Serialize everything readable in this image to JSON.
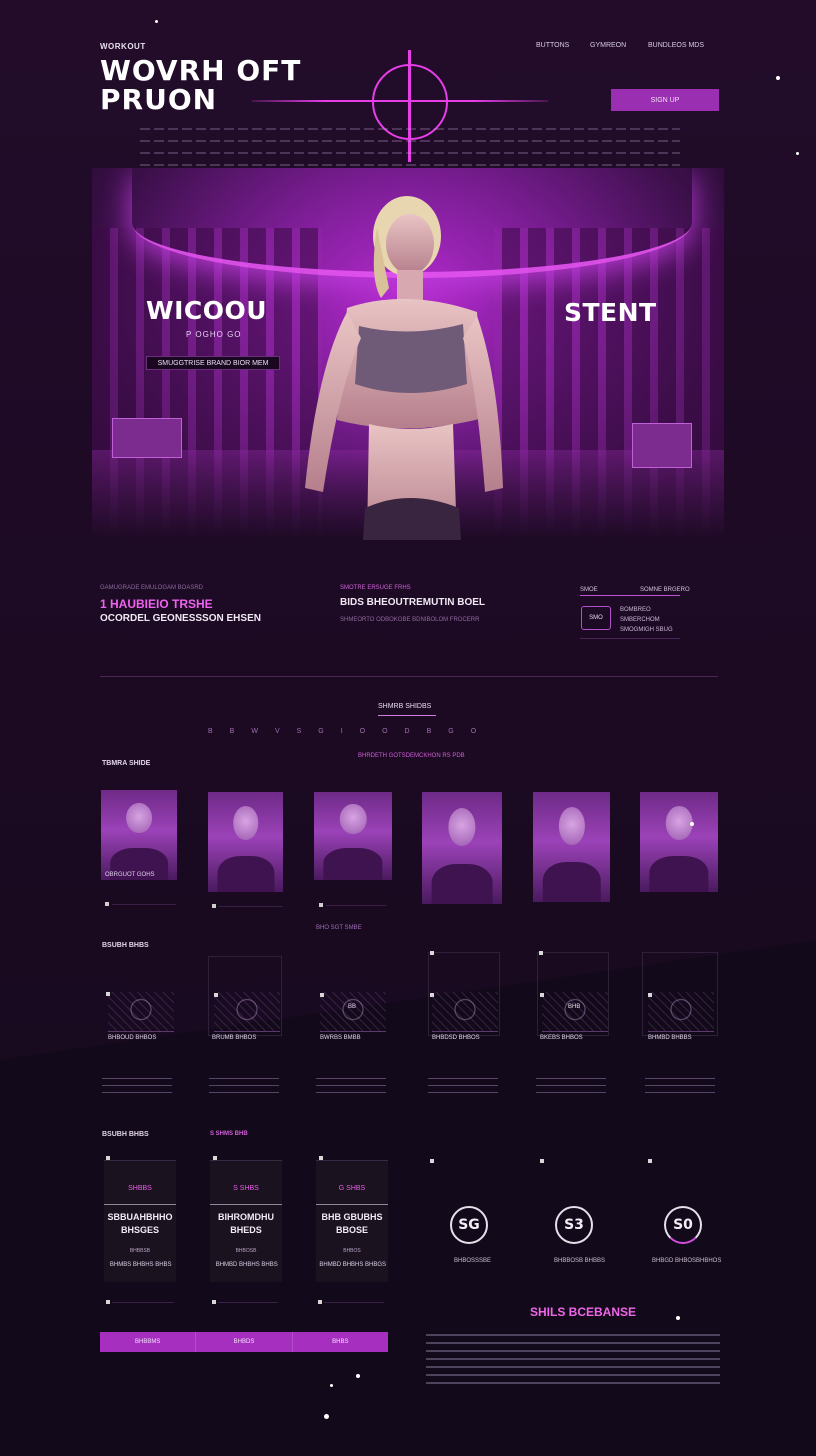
{
  "header": {
    "tagline": "WORKOUT",
    "brand_line1": "WOVRH OFT",
    "brand_line2": "PRUON",
    "nav": [
      "BUTTONS",
      "GYMREON",
      "BUNDLEOS MDS"
    ],
    "cta_label": "SIGN UP"
  },
  "hero": {
    "left_title": "WICOOU",
    "left_subtitle": "P OGHO GO",
    "left_bar": "SMUGGTRISE BRAND BIOR MEM",
    "right_title": "STENT"
  },
  "info": {
    "col1_small": "GAMUGRADE EMULOGAM BOASRD",
    "col1_pink": "1 HAUBIEIO TRSHE",
    "col1_white": "OCORDEL GEONESSSON EHSEN",
    "col2_small": "SMOTRE ERSUGE FRHS",
    "col2_white": "BIDS BHEOUTREMUTIN BOEL",
    "col2_small2": "SHMEORTO ODBOKOBE BDNIBOLOM FROCERR",
    "col3_small": "SMOE",
    "col3_small_r": "SOMNE BRGERO",
    "col3_box": "SMO",
    "col3_line1": "BOMBREO",
    "col3_line2": "SMBERCHOM",
    "col3_line3": "SMOGMIGH SBUG"
  },
  "programs": {
    "title": "SHMRB SHIDBS",
    "dots": "BBWVSGIOODBGO",
    "subtitle": "BHRDETH GOTSDEMCKHON RS PDB",
    "trainers_label": "TBMRA SHIDE",
    "trainer_captions": [
      "OBRGUOT GOHS"
    ],
    "center_caption": "BHO SGT SMBE"
  },
  "classes": {
    "label": "BSUBH BHBS",
    "captions": [
      "BHBOUD BHBOS",
      "BRUMB BHBOS",
      "BWRBS BMBB",
      "BHBDSD BHBOS",
      "BKEBS BHBOS",
      "BHMBD BHBBS"
    ],
    "sketch_labels": [
      "",
      "",
      "BB",
      "",
      "BHB",
      ""
    ]
  },
  "plans": {
    "label": "BSUBH BHBS",
    "label_pink": "S SHMS BHB",
    "cards": [
      {
        "price": "SHBBS",
        "name_line1": "SBBUAHBHHO",
        "name_line2": "BHSGES",
        "line1": "BHBBSB",
        "line2": "BHMBS BHBHS BHBS"
      },
      {
        "price": "S SHBS",
        "name_line1": "BIHROMDHU",
        "name_line2": "BHEDS",
        "line1": "BHBOSB",
        "line2": "BHMBD BHBHS BHBS"
      },
      {
        "price": "G SHBS",
        "name_line1": "BHB GBUBHS",
        "name_line2": "BBOSE",
        "line1": "BHBOS",
        "line2": "BHMBD BHBHS BHBGS"
      }
    ],
    "buttons": [
      "BHBBMS",
      "BHBDS",
      "BHBS"
    ]
  },
  "badges": {
    "items": [
      {
        "glyph": "SG",
        "caption": "BHBOSSSBE"
      },
      {
        "glyph": "S3",
        "caption": "BHBBOSB BHBBS"
      },
      {
        "glyph": "S0",
        "caption": "BHBGD BHBOSBHBHOS"
      }
    ]
  },
  "newsletter": {
    "title": "SHILS BCEBANSE"
  },
  "colors": {
    "accent": "#e73ee8",
    "button": "#9a2fb2",
    "background": "#1d0a24"
  }
}
